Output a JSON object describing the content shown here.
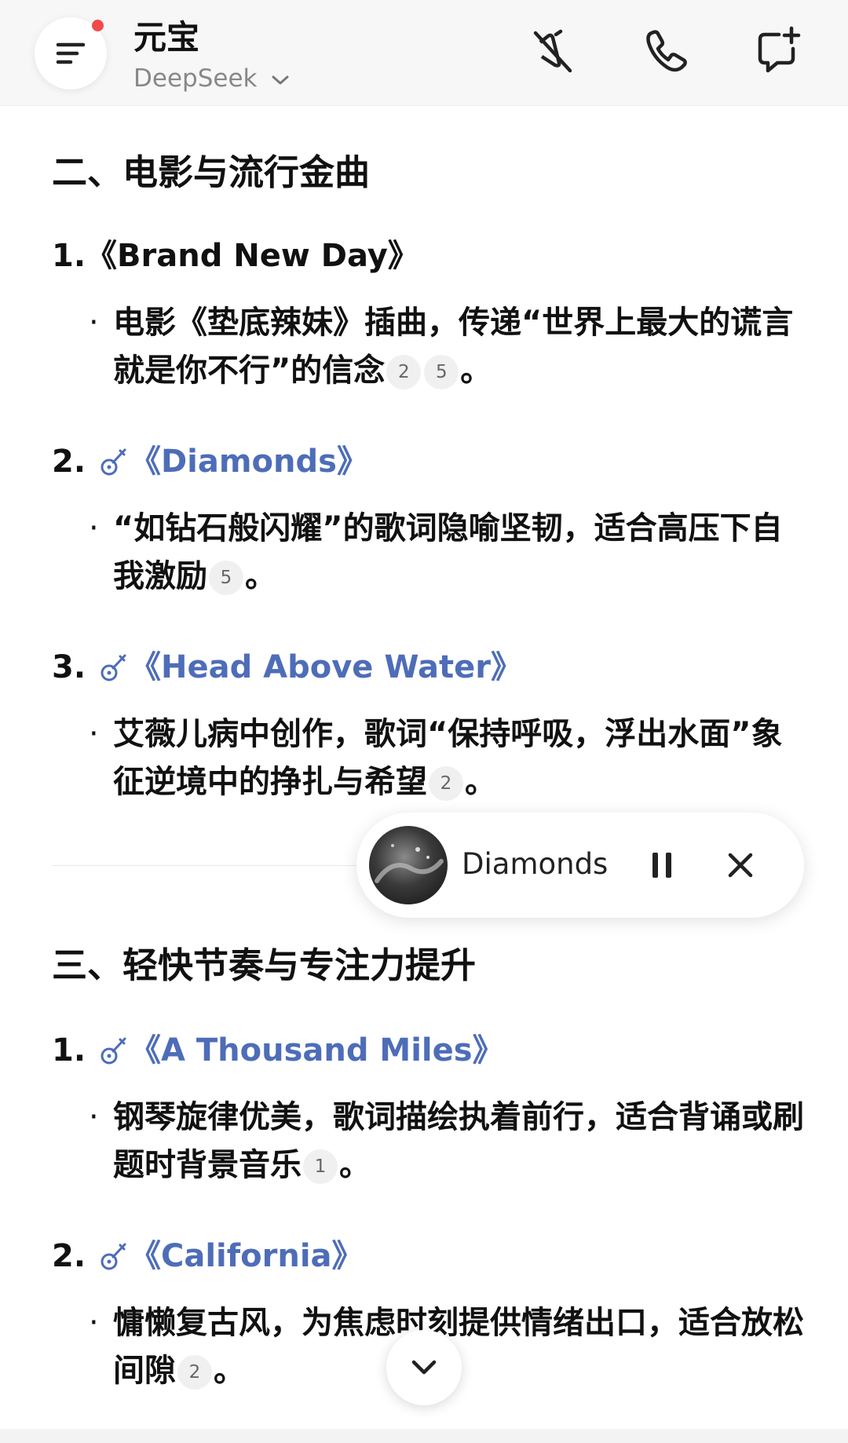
{
  "header": {
    "title": "元宝",
    "model": "DeepSeek"
  },
  "sections": [
    {
      "heading": "二、电影与流行金曲",
      "items": [
        {
          "number": "1.",
          "title": "《Brand New Day》",
          "desc": "电影《垫底辣妹》插曲，传递“世界上最大的谎言就是你不行”的信念",
          "cites": [
            "2",
            "5"
          ],
          "end": "。"
        },
        {
          "number": "2.",
          "title": "《Diamonds》",
          "desc": "“如钻石般闪耀”的歌词隐喻坚韧，适合高压下自我激励",
          "cites": [
            "5"
          ],
          "end": "。"
        },
        {
          "number": "3.",
          "title": "《Head Above Water》",
          "desc": "艾薇儿病中创作，歌词“保持呼吸，浮出水面”象征逆境中的挣扎与希望",
          "cites": [
            "2"
          ],
          "end": "。"
        }
      ]
    },
    {
      "heading": "三、轻快节奏与专注力提升",
      "items": [
        {
          "number": "1.",
          "title": "《A Thousand Miles》",
          "desc": "钢琴旋律优美，歌词描绘执着前行，适合背诵或刷题时背景音乐",
          "cites": [
            "1"
          ],
          "end": "。"
        },
        {
          "number": "2.",
          "title": "《California》",
          "desc": "慵懒复古风，为焦虑时刻提供情绪出口，适合放松间隙",
          "cites": [
            "2"
          ],
          "end": "。"
        }
      ]
    }
  ],
  "bullet_char": "·",
  "player": {
    "song": "Diamonds"
  },
  "colors": {
    "link": "#4e6db8",
    "notification_dot": "#f14a4a"
  }
}
